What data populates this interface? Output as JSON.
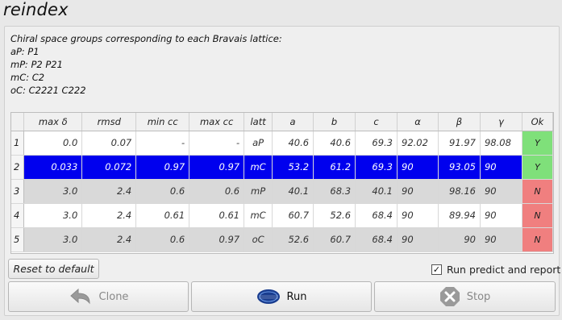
{
  "window": {
    "title": "reindex"
  },
  "description": {
    "lines": [
      "Chiral space groups corresponding to each Bravais lattice:",
      "aP: P1",
      "mP: P2 P21",
      "mC: C2",
      "oC: C2221 C222"
    ]
  },
  "table": {
    "headers": [
      "max δ",
      "rmsd",
      "min cc",
      "max cc",
      "latt",
      "a",
      "b",
      "c",
      "α",
      "β",
      "γ",
      "Ok"
    ],
    "rows": [
      {
        "num": "1",
        "max_delta": "0.0",
        "rmsd": "0.07",
        "min_cc": "-",
        "max_cc": "-",
        "latt": "aP",
        "a": "40.6",
        "b": "40.6",
        "c": "69.3",
        "alpha": "92.02",
        "beta": "91.97",
        "gamma": "98.08",
        "ok": "Y",
        "style": "white",
        "ok_color": "#7fe07a"
      },
      {
        "num": "2",
        "max_delta": "0.033",
        "rmsd": "0.072",
        "min_cc": "0.97",
        "max_cc": "0.97",
        "latt": "mC",
        "a": "53.2",
        "b": "61.2",
        "c": "69.3",
        "alpha": "90",
        "beta": "93.05",
        "gamma": "90",
        "ok": "Y",
        "style": "selected",
        "ok_color": "#7fe07a"
      },
      {
        "num": "3",
        "max_delta": "3.0",
        "rmsd": "2.4",
        "min_cc": "0.6",
        "max_cc": "0.6",
        "latt": "mP",
        "a": "40.1",
        "b": "68.3",
        "c": "40.1",
        "alpha": "90",
        "beta": "98.16",
        "gamma": "90",
        "ok": "N",
        "style": "gray",
        "ok_color": "#f07f7f"
      },
      {
        "num": "4",
        "max_delta": "3.0",
        "rmsd": "2.4",
        "min_cc": "0.61",
        "max_cc": "0.61",
        "latt": "mC",
        "a": "60.7",
        "b": "52.6",
        "c": "68.4",
        "alpha": "90",
        "beta": "89.94",
        "gamma": "90",
        "ok": "N",
        "style": "white",
        "ok_color": "#f07f7f"
      },
      {
        "num": "5",
        "max_delta": "3.0",
        "rmsd": "2.4",
        "min_cc": "0.6",
        "max_cc": "0.97",
        "latt": "oC",
        "a": "52.6",
        "b": "60.7",
        "c": "68.4",
        "alpha": "90",
        "beta": "90",
        "gamma": "90",
        "ok": "N",
        "style": "gray",
        "ok_color": "#f07f7f"
      }
    ]
  },
  "controls": {
    "reset_label": "Reset to default",
    "run_predict_label": "Run predict and report",
    "run_predict_checked": true,
    "clone_label": "Clone",
    "run_label": "Run",
    "stop_label": "Stop"
  },
  "colors": {
    "selection": "#0000ee",
    "ok_yes": "#7fe07a",
    "ok_no": "#f07f7f"
  }
}
